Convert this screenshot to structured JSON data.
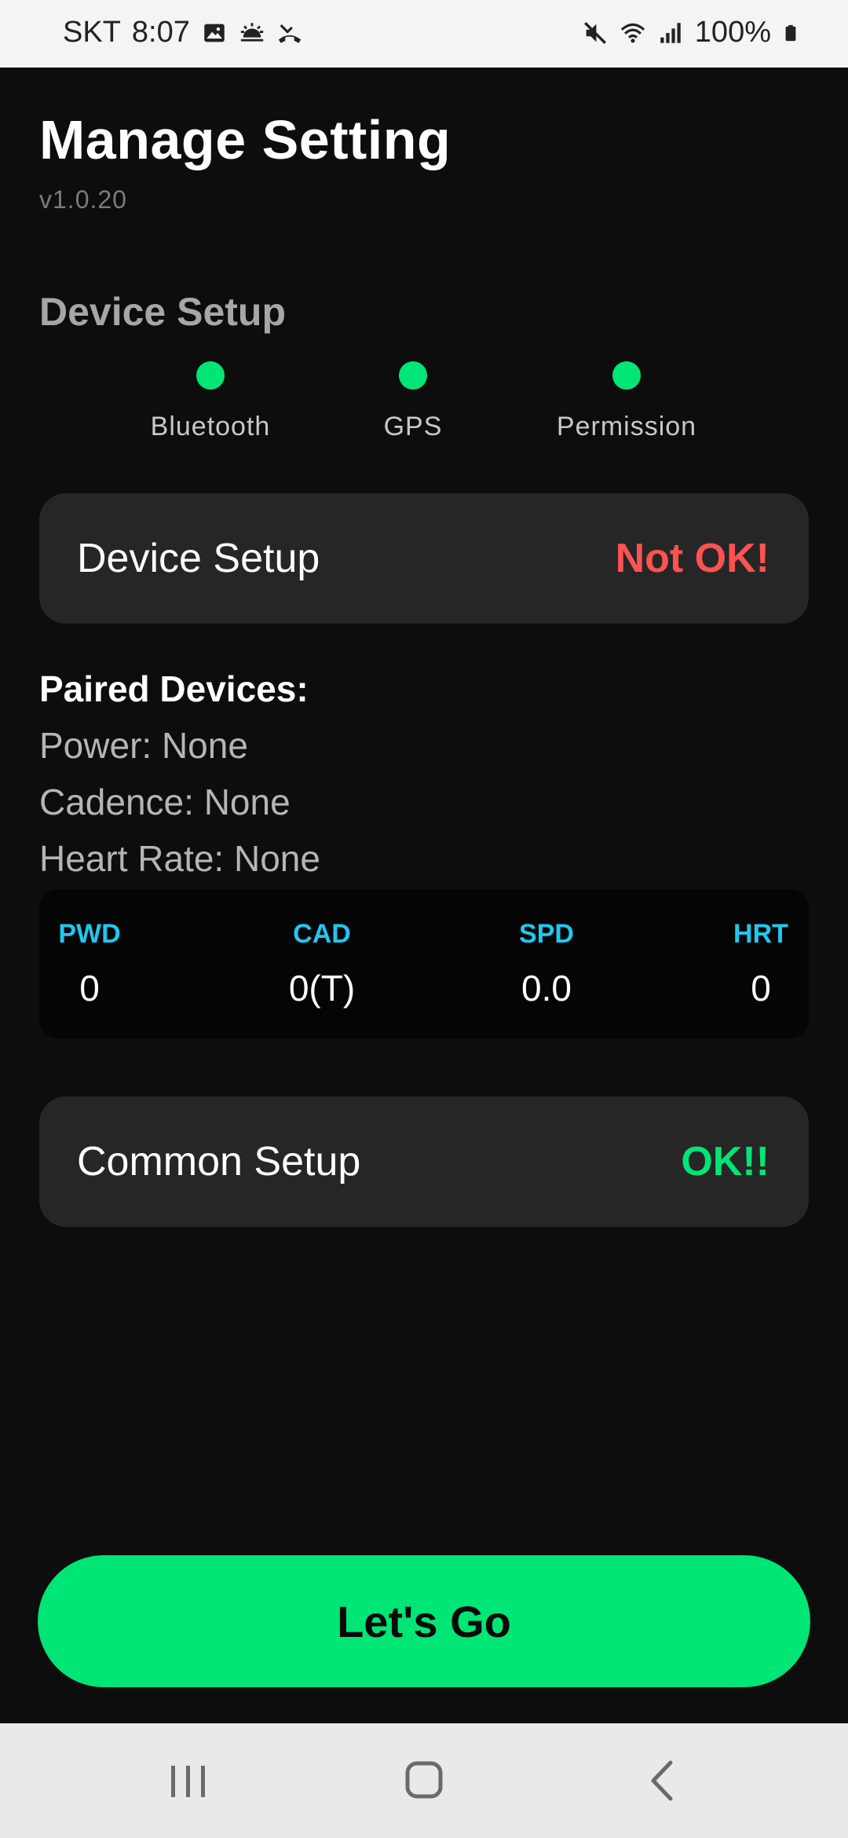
{
  "status_bar": {
    "carrier": "SKT",
    "time": "8:07",
    "battery": "100%",
    "icons_left": [
      "image-icon",
      "weather-icon",
      "missed-call-icon"
    ],
    "icons_right": [
      "mute-icon",
      "wifi-icon",
      "signal-icon",
      "battery-icon"
    ]
  },
  "header": {
    "title": "Manage Setting",
    "version": "v1.0.20"
  },
  "device_setup": {
    "section_title": "Device Setup",
    "indicators": [
      {
        "label": "Bluetooth",
        "status": "ok"
      },
      {
        "label": "GPS",
        "status": "ok"
      },
      {
        "label": "Permission",
        "status": "ok"
      }
    ],
    "indicator_color": "#00e676",
    "card_label": "Device Setup",
    "card_status": "Not OK!",
    "card_status_color": "#ff5252"
  },
  "paired": {
    "title": "Paired Devices:",
    "power": "Power: None",
    "cadence": "Cadence: None",
    "heart_rate": "Heart Rate: None"
  },
  "metrics": [
    {
      "label": "PWD",
      "value": "0"
    },
    {
      "label": "CAD",
      "value": "0(T)"
    },
    {
      "label": "SPD",
      "value": "0.0"
    },
    {
      "label": "HRT",
      "value": "0"
    }
  ],
  "metric_label_color": "#1ec8f0",
  "common_setup": {
    "card_label": "Common Setup",
    "card_status": "OK!!",
    "card_status_color": "#00e676"
  },
  "action": {
    "label": "Let's Go",
    "color": "#00e676"
  },
  "nav_bar": {
    "buttons": [
      "recent-apps-icon",
      "home-icon",
      "back-icon"
    ]
  }
}
